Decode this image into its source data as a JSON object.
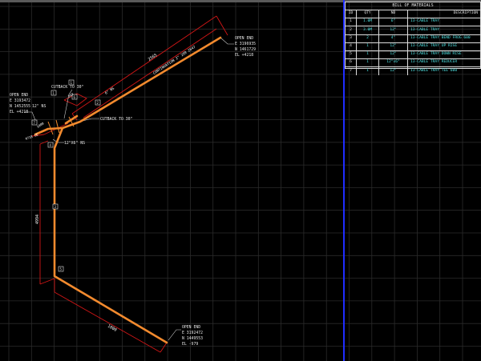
{
  "colors": {
    "background": "#000000",
    "grid": "#2b2b2b",
    "tray": "#f28a2e",
    "dimension": "#d11616",
    "text": "#e6e6e6",
    "bom_text": "#4fe3e3",
    "separator": "#1f2dff"
  },
  "bom": {
    "title": "BILL OF MATERIALS",
    "headers": [
      "ID",
      "QTY",
      "ND",
      "DESCRIPTION"
    ],
    "rows": [
      {
        "id": "1",
        "qty": "1.0M",
        "nd": "6\"",
        "desc": "13-CABLE TRAY"
      },
      {
        "id": "2",
        "qty": "3.0M",
        "nd": "12\"",
        "desc": "13-CABLE TRAY"
      },
      {
        "id": "3",
        "qty": "2",
        "nd": "4\"",
        "desc": "13-CABLE TRAY BEND FROG 600"
      },
      {
        "id": "4",
        "qty": "1",
        "nd": "12\"",
        "desc": "13-CABLE TRAY UP RISE"
      },
      {
        "id": "5",
        "qty": "1",
        "nd": "12\"",
        "desc": "13-CABLE TRAY DOWN RISE"
      },
      {
        "id": "6",
        "qty": "1",
        "nd": "12\"x6\"",
        "desc": "13-CABLE TRAY REDUCER"
      },
      {
        "id": "7",
        "qty": "1",
        "nd": "12\"",
        "desc": "13-CABLE TRAY TEE 600"
      }
    ]
  },
  "annotations": {
    "open_end_top": [
      "OPEN END",
      "E 3196935",
      "N 1461729",
      "EL +4218"
    ],
    "open_end_left": [
      "OPEN END",
      "E 3193472",
      "N 1452555",
      "12\" NS",
      "EL +4218"
    ],
    "open_end_bottom": [
      "OPEN END",
      "E 3192472",
      "N 1449553",
      "EL -979"
    ],
    "cutback_1": "CUTBACK TO 30\"",
    "cutback_2": "CUTBACK TO 30\"",
    "ns_label": "12\"X6\" NS",
    "size_6ns": "6\" NS",
    "dim_top": "2565",
    "dim_run": "CONTINUATION 2\" 289 2647",
    "dim_vertical": "4994",
    "dim_bottom": "1800",
    "dim_small_1": "342",
    "dim_small_2": "4718 CE",
    "dim_1000": "1000",
    "tags": [
      "1",
      "2",
      "3",
      "4",
      "5",
      "6",
      "7",
      "1"
    ]
  }
}
